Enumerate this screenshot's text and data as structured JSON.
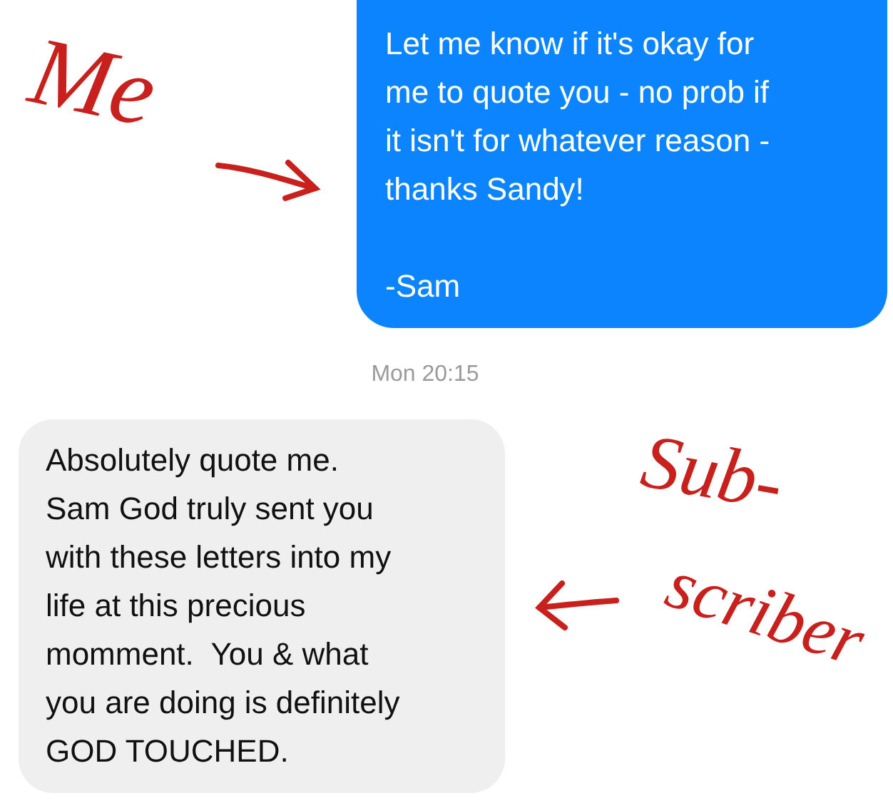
{
  "messages": [
    {
      "kind": "sent",
      "text": "Let me know if it's okay for\nme to quote you - no prob if\nit isn't for whatever reason -\nthanks Sandy!\n\n-Sam"
    },
    {
      "kind": "timestamp",
      "text": "Mon 20:15"
    },
    {
      "kind": "received",
      "text": "Absolutely quote me.\nSam God truly sent you\nwith these letters into my\nlife at this precious\nmomment.  You & what\nyou are doing is definitely\nGOD TOUCHED."
    }
  ],
  "annotations": [
    {
      "kind": "me",
      "lines": [
        "Me"
      ]
    },
    {
      "kind": "subscriber",
      "lines": [
        "Sub-",
        "scriber"
      ]
    }
  ]
}
